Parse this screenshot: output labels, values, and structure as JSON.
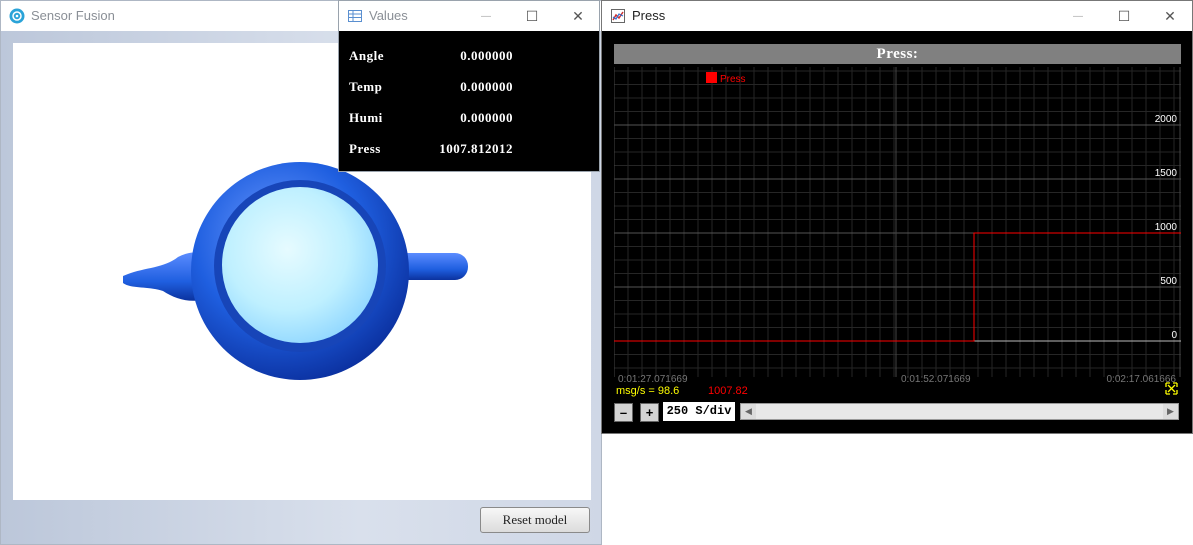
{
  "fusion_window": {
    "title": "Sensor Fusion",
    "reset_label": "Reset model"
  },
  "values_window": {
    "title": "Values",
    "rows": [
      {
        "key": "Angle",
        "value": "0.000000"
      },
      {
        "key": "Temp",
        "value": "0.000000"
      },
      {
        "key": "Humi",
        "value": "0.000000"
      },
      {
        "key": "Press",
        "value": "1007.812012"
      }
    ]
  },
  "press_window": {
    "title": "Press",
    "header": "Press:",
    "legend": "Press",
    "msg_rate": "msg/s = 98.6",
    "current_value": "1007.82",
    "div_label": "250 S/div",
    "minus_label": "–",
    "plus_label": "+"
  },
  "window_controls": {
    "minimize": "—",
    "maximize": "☐",
    "close": "✕"
  },
  "colors": {
    "series": "#ff0000",
    "teapot": "#1f5fe0",
    "teapot_inner": "#c8f2ff",
    "msg_rate": "#ffff00"
  },
  "icons": {
    "fusion": "sensor-fusion-icon",
    "values": "table-icon",
    "press": "chart-icon"
  },
  "chart_data": {
    "type": "line",
    "series": [
      {
        "name": "Press",
        "x": [
          "0:01:27.071669",
          "0:02:01",
          "0:02:01",
          "0:02:17.061666"
        ],
        "y": [
          0,
          0,
          1000,
          1000
        ]
      }
    ],
    "x_ticks": [
      "0:01:27.071669",
      "0:01:52.071669",
      "0:02:17.061666"
    ],
    "y_ticks": [
      0,
      500,
      1000,
      1500,
      2000
    ],
    "ylim": [
      0,
      2500
    ],
    "grid": true,
    "legend_position": "top-left"
  }
}
